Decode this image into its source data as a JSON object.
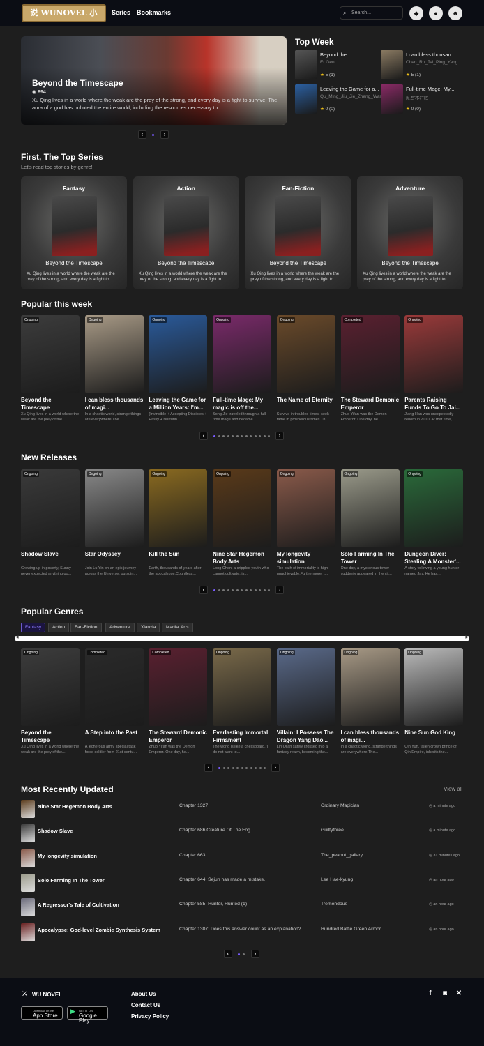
{
  "header": {
    "logo_text": "说 WUNOVEL 小",
    "nav": [
      "Series",
      "Bookmarks"
    ],
    "search_placeholder": "Search..."
  },
  "hero": {
    "title": "Beyond the Timescape",
    "views": "894",
    "description": "Xu Qing lives in a world where the weak are the prey of the strong, and every day is a fight to survive. The aura of a god has polluted the entire world, including the resources necessary to..."
  },
  "top_week": {
    "title": "Top Week",
    "items": [
      {
        "title": "Beyond the...",
        "author": "Er Gen",
        "rating": "5 (1)",
        "color": "#555"
      },
      {
        "title": "I can bless thousan...",
        "author": "Chen_Ru_Tai_Ping_Yang",
        "rating": "5 (1)",
        "color": "#8a7a62"
      },
      {
        "title": "Leaving the Game for a...",
        "author": "Qu_Ming_Jiu_Jie_Zheng_Wan_Qi",
        "rating": "0 (0)",
        "color": "#2b5fa0"
      },
      {
        "title": "Full-time Mage: My...",
        "author": "乱写不行吗",
        "rating": "0 (0)",
        "color": "#8a2a66"
      }
    ]
  },
  "top_series": {
    "title": "First, The Top Series",
    "subtitle": "Let's read top stories by genre!",
    "genres": [
      {
        "genre": "Fantasy",
        "name": "Beyond the Timescape",
        "desc": "Xu Qing lives in a world where the weak are the prey of the strong, and every day is a fight to..."
      },
      {
        "genre": "Action",
        "name": "Beyond the Timescape",
        "desc": "Xu Qing lives in a world where the weak are the prey of the strong, and every day is a fight to..."
      },
      {
        "genre": "Fan-Fiction",
        "name": "Beyond the Timescape",
        "desc": "Xu Qing lives in a world where the weak are the prey of the strong, and every day is a fight to..."
      },
      {
        "genre": "Adventure",
        "name": "Beyond the Timescape",
        "desc": "Xu Qing lives in a world where the weak are the prey of the strong, and every day is a fight to..."
      }
    ]
  },
  "popular_week": {
    "title": "Popular this week",
    "items": [
      {
        "badge": "Ongoing",
        "title": "Beyond the Timescape",
        "desc": "Xu Qing lives in a world where the weak are the prey of the...",
        "color": "#3c3c3c"
      },
      {
        "badge": "Ongoing",
        "title": "I can bless thousands of magi...",
        "desc": "In a chaotic world, strange things are everywhere.The...",
        "color": "#a89a86"
      },
      {
        "badge": "Ongoing",
        "title": "Leaving the Game for a Million Years: I'm...",
        "desc": "(Invincible + Accepting Disciples + Easily + Nurturin...",
        "color": "#2a5a9a"
      },
      {
        "badge": "Ongoing",
        "title": "Full-time Mage: My magic is off the...",
        "desc": "Song Jie traveled through a full-time mage and became...",
        "color": "#7a2a6a"
      },
      {
        "badge": "Ongoing",
        "title": "The Name of Eternity",
        "desc": "Survive in troubled times, seek fame in prosperous times.Th...",
        "color": "#6a4a2a"
      },
      {
        "badge": "Completed",
        "title": "The Steward Demonic Emperor",
        "desc": "Zhuo Yifan was the Demon Emperor. One day, he...",
        "color": "#5a2030"
      },
      {
        "badge": "Ongoing",
        "title": "Parents Raising Funds To Go To Jai...",
        "desc": "Jiang Han was unexpectedly reborn in 2010. At that time,...",
        "color": "#9a3a3a"
      }
    ]
  },
  "new_releases": {
    "title": "New Releases",
    "items": [
      {
        "badge": "Ongoing",
        "title": "Shadow Slave",
        "desc": "Growing up in poverty, Sunny never expected anything go...",
        "color": "#3a3a3a"
      },
      {
        "badge": "Ongoing",
        "title": "Star Odyssey",
        "desc": "Join Lu Yin on an epic journey across the Universe, pursuin...",
        "color": "#888"
      },
      {
        "badge": "Ongoing",
        "title": "Kill the Sun",
        "desc": "Earth, thousands of years after the apocalypse.Countless...",
        "color": "#8a6a20"
      },
      {
        "badge": "Ongoing",
        "title": "Nine Star Hegemon Body Arts",
        "desc": "Long Chen, a crippled youth who cannot cultivate, is...",
        "color": "#5a3a1a"
      },
      {
        "badge": "Ongoing",
        "title": "My longevity simulation",
        "desc": "The path of immortality is high unachievable.Furthermore, t...",
        "color": "#8a5a4a"
      },
      {
        "badge": "Ongoing",
        "title": "Solo Farming In The Tower",
        "desc": "One day, a mysterious tower suddenly appeared in the cit...",
        "color": "#9a9a8a"
      },
      {
        "badge": "Ongoing",
        "title": "Dungeon Diver: Stealing A Monster'...",
        "desc": "A story following a young hunter named Jay. He has...",
        "color": "#2a6a3a"
      }
    ]
  },
  "popular_genres": {
    "title": "Popular Genres",
    "tabs": [
      "Fantasy",
      "Action",
      "Fan-Fiction",
      "Adventure",
      "Xianxia",
      "Martial Arts"
    ],
    "items": [
      {
        "badge": "Ongoing",
        "title": "Beyond the Timescape",
        "desc": "Xu Qing lives in a world where the weak are the prey of the...",
        "color": "#3c3c3c"
      },
      {
        "badge": "Completed",
        "title": "A Step into the Past",
        "desc": "A lecherous army special task force soldier from 21st-centu...",
        "color": "#2a2a2a"
      },
      {
        "badge": "Completed",
        "title": "The Steward Demonic Emperor",
        "desc": "Zhuo Yifan was the Demon Emperor. One day, he...",
        "color": "#5a2030"
      },
      {
        "badge": "Ongoing",
        "title": "Everlasting Immortal Firmament",
        "desc": "The world is like a chessboard.\"I do not want to...",
        "color": "#7a6a4a"
      },
      {
        "badge": "Ongoing",
        "title": "Villain: I Possess The Dragon Yang Dao...",
        "desc": "Lin Qi'an safely crossed into a fantasy realm, becoming the...",
        "color": "#5a6a8a"
      },
      {
        "badge": "Ongoing",
        "title": "I can bless thousands of magi...",
        "desc": "In a chaotic world, strange things are everywhere.The...",
        "color": "#a89a86"
      },
      {
        "badge": "Ongoing",
        "title": "Nine Sun God King",
        "desc": "Qin Yun, fallen crown prince of Qin Empire, inherits the...",
        "color": "#bbb"
      }
    ]
  },
  "recent": {
    "title": "Most Recently Updated",
    "view_all": "View all",
    "rows": [
      {
        "title": "Nine Star Hegemon Body Arts",
        "chapter": "Chapter 1327",
        "author": "Ordinary Magician",
        "time": "a minute ago",
        "color": "#5a3a1a"
      },
      {
        "title": "Shadow Slave",
        "chapter": "Chapter 686 Creature Of The Fog",
        "author": "Guiltythree",
        "time": "a minute ago",
        "color": "#3a3a3a"
      },
      {
        "title": "My longevity simulation",
        "chapter": "Chapter 663",
        "author": "The_peanut_gallary",
        "time": "31 minutes ago",
        "color": "#8a5a4a"
      },
      {
        "title": "Solo Farming In The Tower",
        "chapter": "Chapter 644: Sejun has made a mistake.",
        "author": "Lee Hae-kyung",
        "time": "an hour ago",
        "color": "#9a9a8a"
      },
      {
        "title": "A Regressor's Tale of Cultivation",
        "chapter": "Chapter 585: Hunter, Hunted (1)",
        "author": "Tremendous",
        "time": "an hour ago",
        "color": "#6a6a7a"
      },
      {
        "title": "Apocalypse: God-level Zombie Synthesis System",
        "chapter": "Chapter 1307: Does this answer count as an explanation?",
        "author": "Hundred Battle Green Armor",
        "time": "an hour ago",
        "color": "#6a2020"
      }
    ]
  },
  "footer": {
    "brand": "WU NOVEL",
    "app_store_small": "Download on the",
    "app_store": "App Store",
    "google_small": "GET IT ON",
    "google_play": "Google Play",
    "links": [
      "About Us",
      "Contact Us",
      "Privacy Policy"
    ]
  }
}
